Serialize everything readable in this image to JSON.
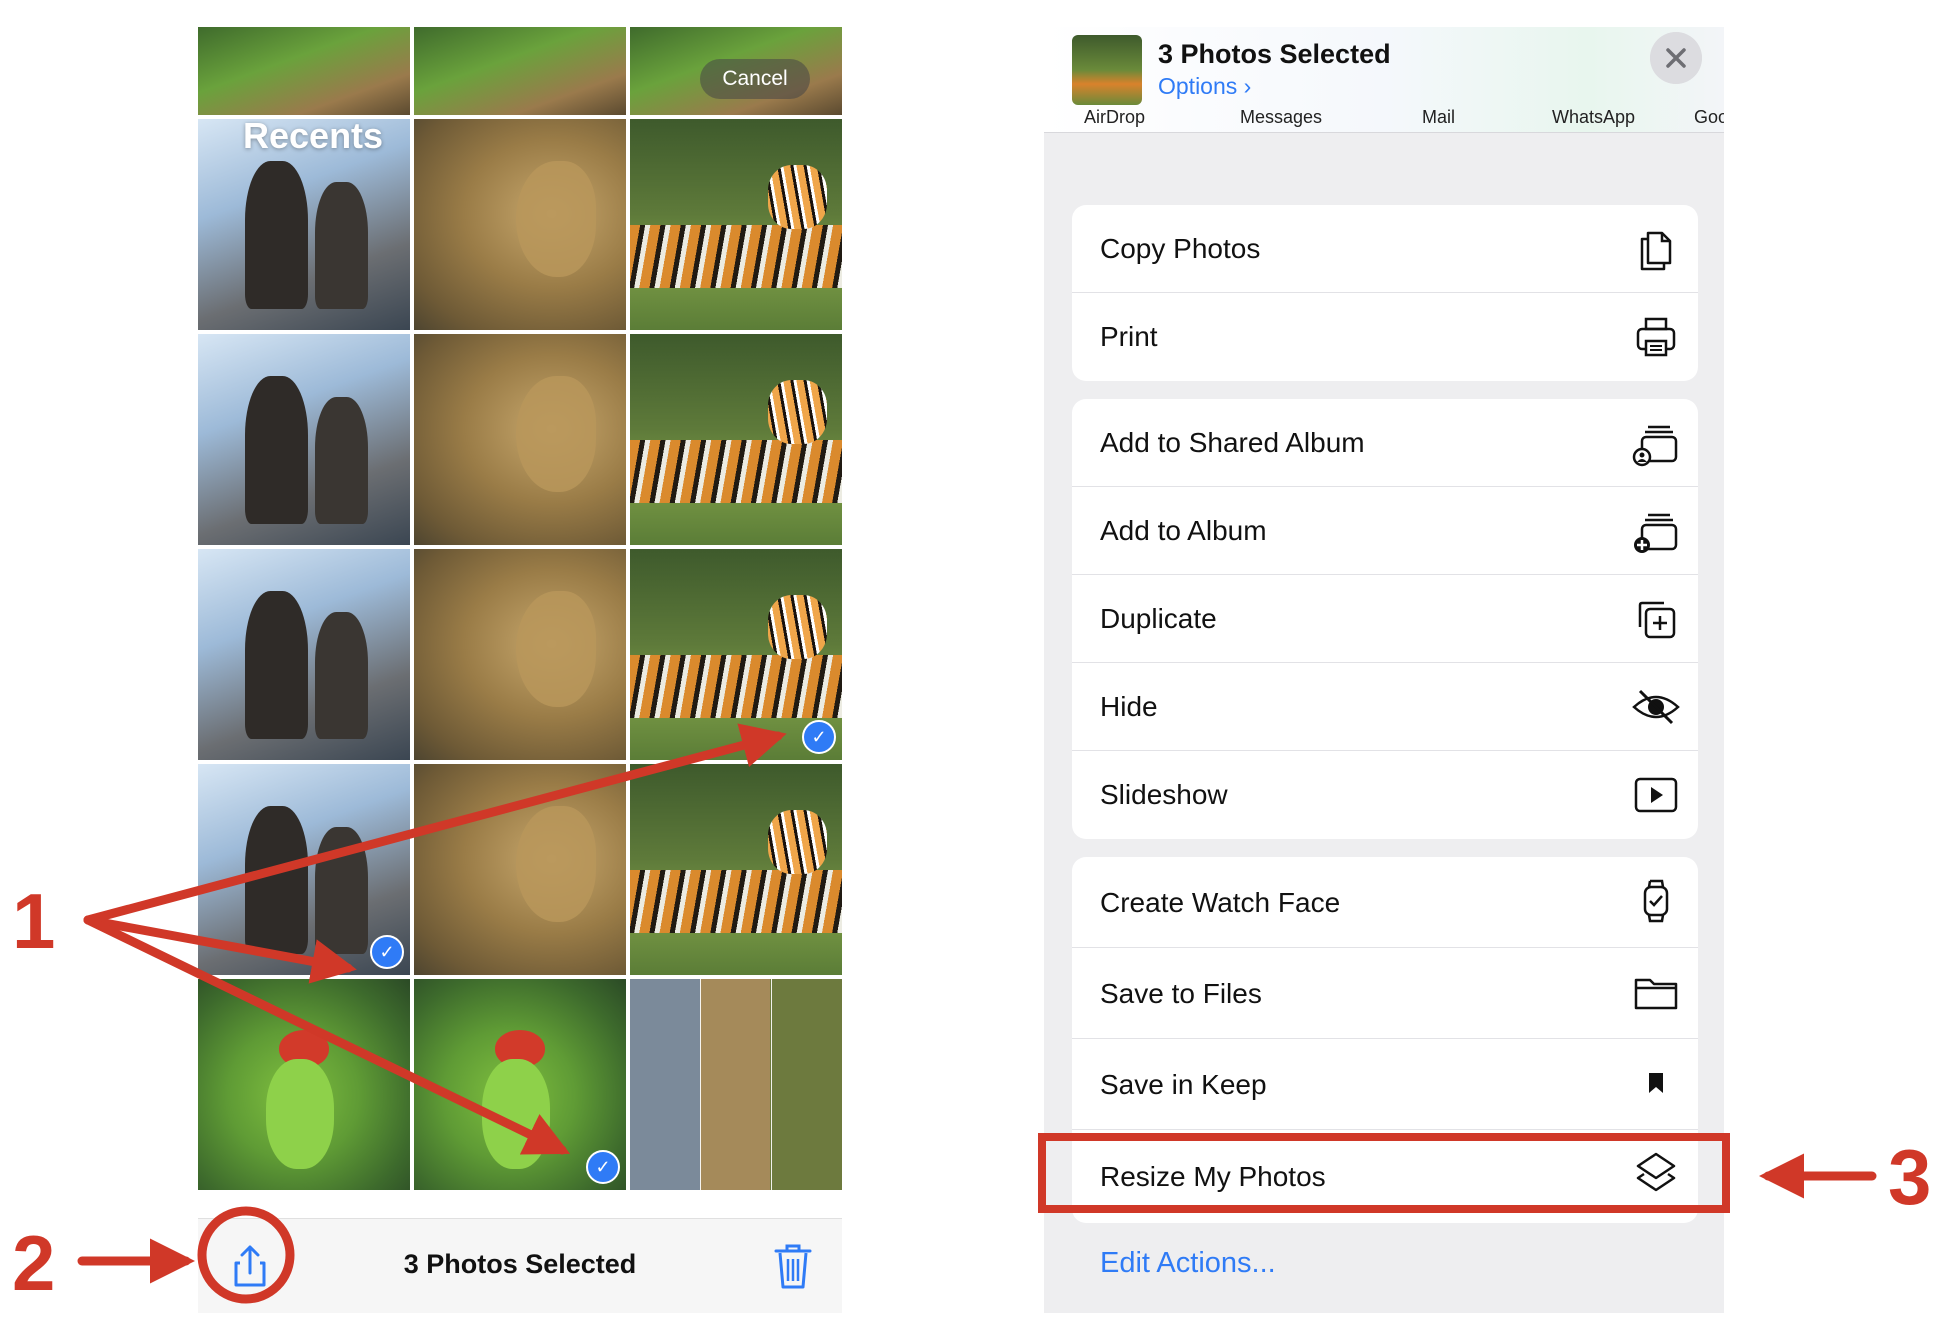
{
  "left_phone": {
    "cancel_label": "Cancel",
    "recents_title": "Recents",
    "selected_count": "3 Photos Selected",
    "checkmark_glyph": "✓",
    "icons": {
      "share": "share-icon",
      "trash": "trash-icon"
    }
  },
  "share_sheet": {
    "title": "3 Photos Selected",
    "options_label": "Options ›",
    "apps": [
      "AirDrop",
      "Messages",
      "Mail",
      "WhatsApp",
      "Goo"
    ],
    "groups": [
      {
        "rows": [
          {
            "label": "Copy Photos",
            "icon": "copy-icon"
          },
          {
            "label": "Print",
            "icon": "printer-icon"
          }
        ]
      },
      {
        "rows": [
          {
            "label": "Add to Shared Album",
            "icon": "shared-album-icon"
          },
          {
            "label": "Add to Album",
            "icon": "add-album-icon"
          },
          {
            "label": "Duplicate",
            "icon": "duplicate-icon"
          },
          {
            "label": "Hide",
            "icon": "eye-slash-icon"
          },
          {
            "label": "Slideshow",
            "icon": "play-icon"
          }
        ]
      },
      {
        "rows": [
          {
            "label": "Create Watch Face",
            "icon": "watch-icon"
          },
          {
            "label": "Save to Files",
            "icon": "folder-icon"
          },
          {
            "label": "Save in Keep",
            "icon": "bookmark-icon"
          },
          {
            "label": "Resize My Photos",
            "icon": "shortcuts-icon"
          }
        ]
      }
    ],
    "edit_actions_label": "Edit Actions..."
  },
  "annotations": {
    "step1": "1",
    "step2": "2",
    "step3": "3"
  },
  "colors": {
    "accent_blue": "#2f7bf6",
    "annotation_red": "#d03828"
  }
}
